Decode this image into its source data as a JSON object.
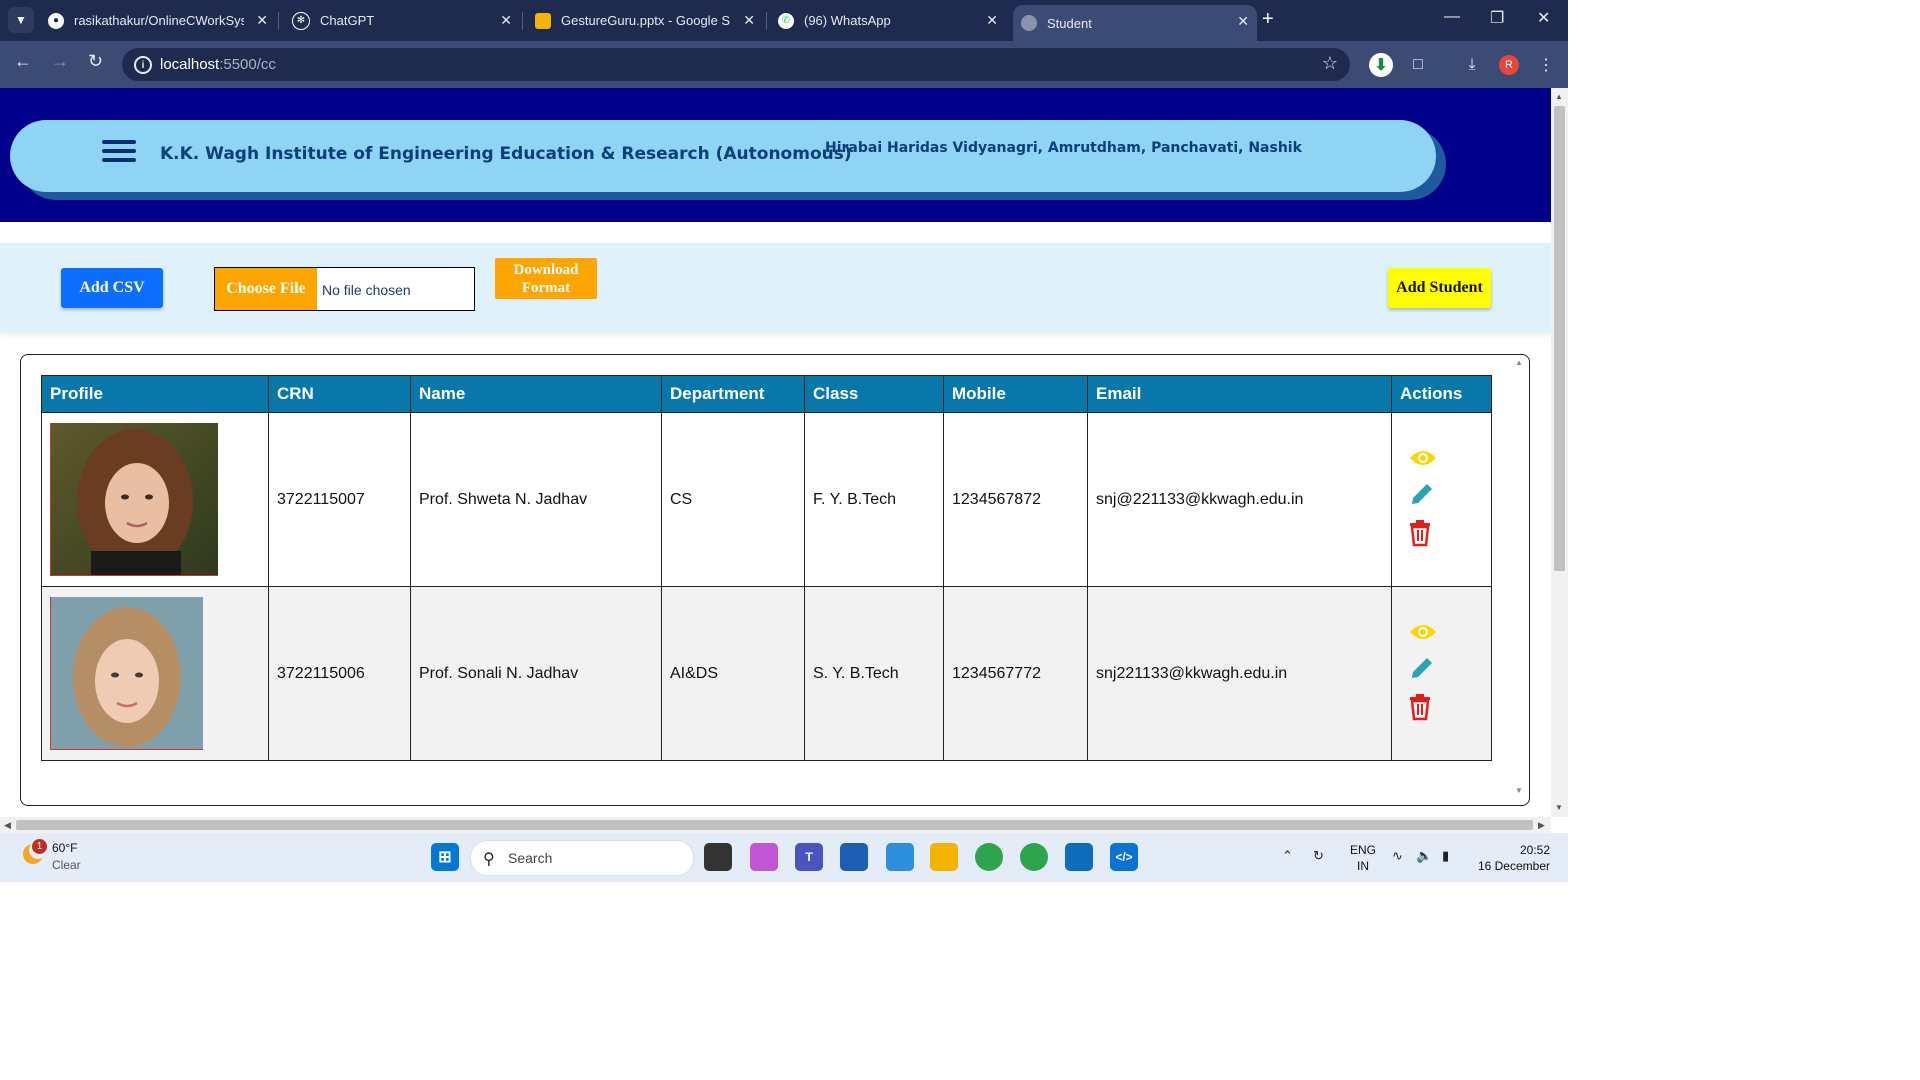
{
  "browser": {
    "tabs": [
      {
        "title": "rasikathakur/OnlineCWorkSyste",
        "icon": "github-icon"
      },
      {
        "title": "ChatGPT",
        "icon": "chatgpt-icon"
      },
      {
        "title": "GestureGuru.pptx - Google Slid",
        "icon": "slides-icon"
      },
      {
        "title": "(96) WhatsApp",
        "icon": "whatsapp-icon"
      },
      {
        "title": "Student",
        "icon": "globe-icon"
      }
    ],
    "url_host": "localhost",
    "url_path": ":5500/cc",
    "profile_letter": "R"
  },
  "header": {
    "institute": "K.K. Wagh Institute of Engineering Education & Research (Autonomous)",
    "address": "Hirabai Haridas Vidyanagri, Amrutdham, Panchavati, Nashik"
  },
  "actions": {
    "add_csv": "Add CSV",
    "choose_file": "Choose File",
    "no_file": "No file chosen",
    "download_format": "Download Format",
    "add_student": "Add Student"
  },
  "table": {
    "columns": [
      "Profile",
      "CRN",
      "Name",
      "Department",
      "Class",
      "Mobile",
      "Email",
      "Actions"
    ],
    "rows": [
      {
        "crn": "3722115007",
        "name": "Prof. Shweta N. Jadhav",
        "department": "CS",
        "class": "F. Y. B.Tech",
        "mobile": "1234567872",
        "email": "snj@221133@kkwagh.edu.in"
      },
      {
        "crn": "3722115006",
        "name": "Prof. Sonali N. Jadhav",
        "department": "AI&DS",
        "class": "S. Y. B.Tech",
        "mobile": "1234567772",
        "email": "snj221133@kkwagh.edu.in"
      }
    ]
  },
  "taskbar": {
    "weather_badge": "1",
    "weather_temp": "60°F",
    "weather_cond": "Clear",
    "search_label": "Search",
    "lang_top": "ENG",
    "lang_bottom": "IN",
    "time": "20:52",
    "date": "16 December"
  },
  "colors": {
    "hero_bg": "#00008b",
    "header_pill": "#8fd3f5",
    "table_header": "#0a77aa",
    "add_csv": "#0d6efd",
    "orange": "#ffa500",
    "add_student": "#ffff00",
    "view_icon": "#ffd400",
    "edit_icon": "#2aa3b8",
    "delete_icon": "#e0211b"
  }
}
